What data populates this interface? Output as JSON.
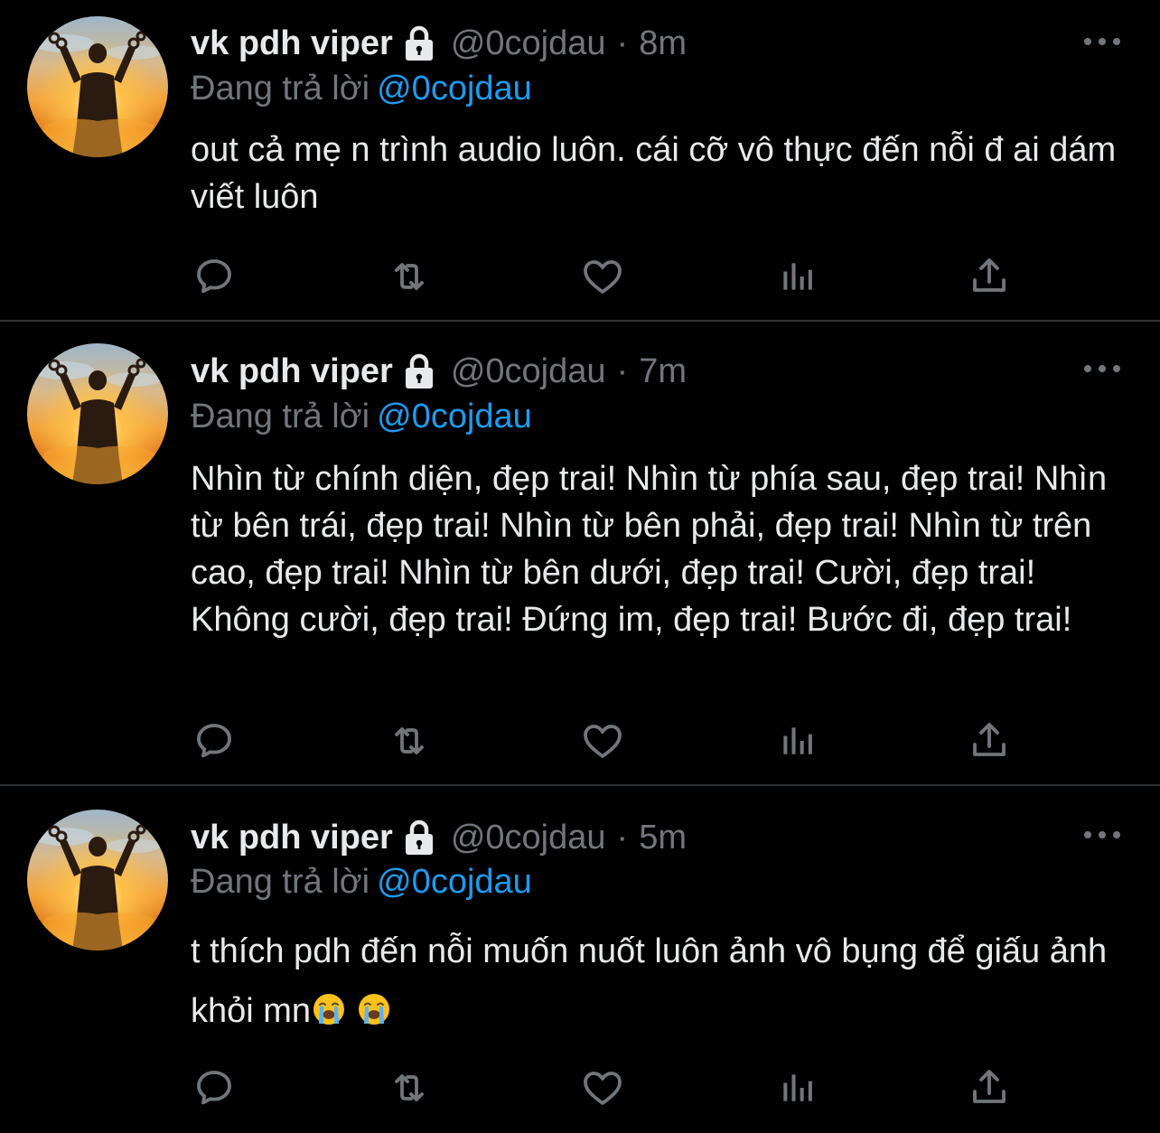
{
  "colors": {
    "background": "#000000",
    "text_primary": "#e7e9ea",
    "text_secondary": "#71767b",
    "link": "#1d9bf0",
    "divider": "#2f3336"
  },
  "tweets": [
    {
      "display_name": "vk pdh viper",
      "handle": "@0cojdau",
      "separator": "·",
      "time": "8m",
      "replying_label": "Đang trả lời",
      "replying_to": "@0cojdau",
      "text": "out cả mẹ n trình audio luôn. cái cỡ vô thực đến nỗi đ ai dám viết luôn",
      "icons": [
        "lock-icon",
        "more-icon",
        "reply-icon",
        "retweet-icon",
        "like-icon",
        "analytics-icon",
        "share-icon"
      ]
    },
    {
      "display_name": "vk pdh viper",
      "handle": "@0cojdau",
      "separator": "·",
      "time": "7m",
      "replying_label": "Đang trả lời",
      "replying_to": "@0cojdau",
      "text": "Nhìn từ chính diện, đẹp trai! Nhìn từ phía sau, đẹp trai! Nhìn từ bên trái, đẹp trai! Nhìn từ bên phải, đẹp trai! Nhìn từ trên cao, đẹp trai! Nhìn từ bên dưới, đẹp trai! Cười, đẹp trai! Không cười, đẹp trai! Đứng im, đẹp trai! Bước đi, đẹp trai!",
      "icons": [
        "lock-icon",
        "more-icon",
        "reply-icon",
        "retweet-icon",
        "like-icon",
        "analytics-icon",
        "share-icon"
      ]
    },
    {
      "display_name": "vk pdh viper",
      "handle": "@0cojdau",
      "separator": "·",
      "time": "5m",
      "replying_label": "Đang trả lời",
      "replying_to": "@0cojdau",
      "text": "t thích pdh đến nỗi muốn nuốt luôn ảnh vô bụng để giấu ảnh khỏi mn",
      "emojis": [
        "loudly-crying-face",
        "loudly-crying-face"
      ],
      "icons": [
        "lock-icon",
        "more-icon",
        "reply-icon",
        "retweet-icon",
        "like-icon",
        "analytics-icon",
        "share-icon"
      ]
    }
  ]
}
